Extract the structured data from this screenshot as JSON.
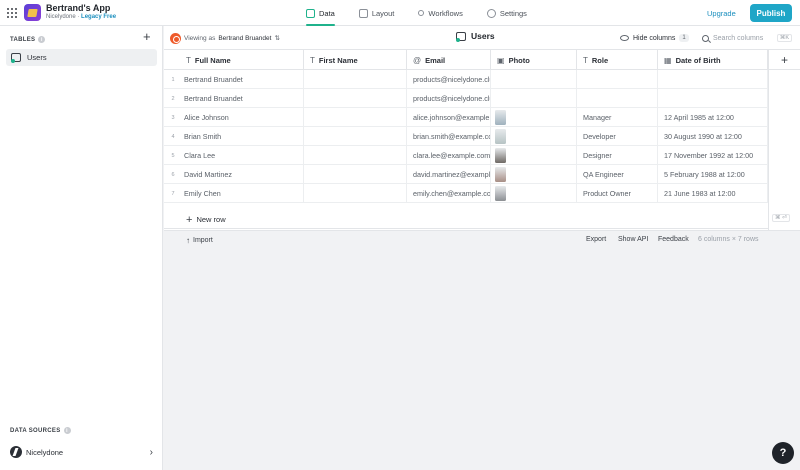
{
  "app": {
    "name": "Bertrand's App",
    "org": "Nicelydone",
    "separator": " · ",
    "plan": "Legacy Free",
    "logo_icon": "truck-icon"
  },
  "nav": {
    "tabs": [
      {
        "label": "Data",
        "icon": "table-icon",
        "active": true
      },
      {
        "label": "Layout",
        "icon": "layout-icon",
        "active": false
      },
      {
        "label": "Workflows",
        "icon": "workflow-icon",
        "active": false
      },
      {
        "label": "Settings",
        "icon": "gear-icon",
        "active": false
      }
    ],
    "upgrade": "Upgrade",
    "publish": "Publish"
  },
  "sidebar": {
    "tables_header": "TABLES",
    "tables": [
      {
        "label": "Users"
      }
    ],
    "sources_header": "DATA SOURCES",
    "sources": [
      {
        "label": "Nicelydone"
      }
    ]
  },
  "toolbar": {
    "viewing_prefix": "Viewing as",
    "viewing_user": "Bertrand Bruandet",
    "table_title": "Users",
    "hide_columns": "Hide columns",
    "hidden_count": "1",
    "search_placeholder": "Search columns",
    "search_shortcut": "⌘K"
  },
  "columns": [
    {
      "label": "Full Name",
      "icon": "T"
    },
    {
      "label": "First Name",
      "icon": "T"
    },
    {
      "label": "Email",
      "icon": "@"
    },
    {
      "label": "Photo",
      "icon": "▣"
    },
    {
      "label": "Role",
      "icon": "T"
    },
    {
      "label": "Date of Birth",
      "icon": "▦"
    }
  ],
  "rows": [
    {
      "n": "1",
      "full_name": "Bertrand Bruandet",
      "first_name": "",
      "email": "products@nicelydone.club",
      "photo": "",
      "role": "",
      "dob": ""
    },
    {
      "n": "2",
      "full_name": "Bertrand Bruandet",
      "first_name": "",
      "email": "products@nicelydone.club",
      "photo": "",
      "role": "",
      "dob": ""
    },
    {
      "n": "3",
      "full_name": "Alice Johnson",
      "first_name": "",
      "email": "alice.johnson@example.com",
      "photo": "#9fb1bd",
      "role": "Manager",
      "dob": "12 April 1985 at 12:00"
    },
    {
      "n": "4",
      "full_name": "Brian Smith",
      "first_name": "",
      "email": "brian.smith@example.com",
      "photo": "#b6c3c4",
      "role": "Developer",
      "dob": "30 August 1990 at 12:00"
    },
    {
      "n": "5",
      "full_name": "Clara Lee",
      "first_name": "",
      "email": "clara.lee@example.com",
      "photo": "#6f6a66",
      "role": "Designer",
      "dob": "17 November 1992 at 12:00"
    },
    {
      "n": "6",
      "full_name": "David Martinez",
      "first_name": "",
      "email": "david.martinez@example.com",
      "photo": "#a88f86",
      "role": "QA Engineer",
      "dob": "5 February 1988 at 12:00"
    },
    {
      "n": "7",
      "full_name": "Emily Chen",
      "first_name": "",
      "email": "emily.chen@example.com",
      "photo": "#8c8f93",
      "role": "Product Owner",
      "dob": "21 June 1983 at 12:00"
    }
  ],
  "grid": {
    "new_row": "New row",
    "shortcut": "⌘ ⏎",
    "import": "Import",
    "export": "Export",
    "show_api": "Show API",
    "feedback": "Feedback",
    "summary": "6 columns × 7 rows"
  },
  "help": "?",
  "colors": {
    "accent": "#1fb28c",
    "publish": "#1fa6c7",
    "link": "#1c8fbe"
  }
}
